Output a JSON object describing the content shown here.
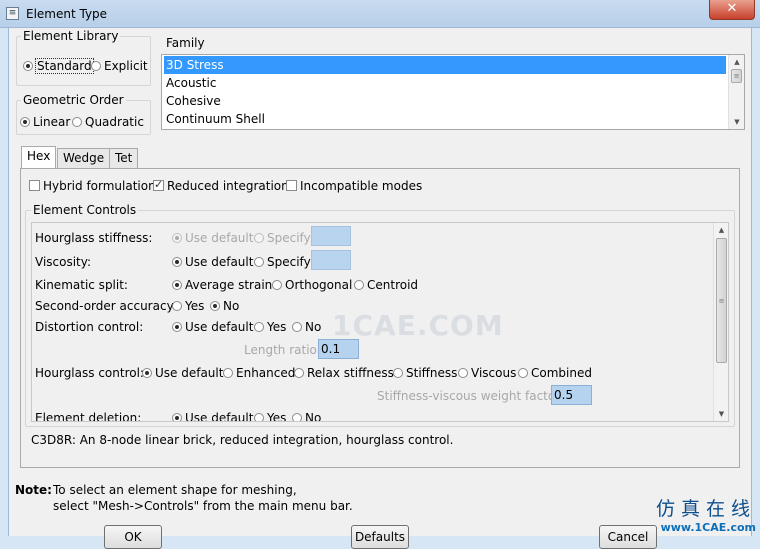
{
  "window": {
    "title": "Element Type",
    "close_glyph": "✕",
    "app_icon": "abaqus-app-icon"
  },
  "element_library": {
    "label": "Element Library",
    "options": [
      "Standard",
      "Explicit"
    ],
    "selected": "Standard"
  },
  "geometric_order": {
    "label": "Geometric Order",
    "options": [
      "Linear",
      "Quadratic"
    ],
    "selected": "Linear"
  },
  "family": {
    "label": "Family",
    "items": [
      "3D Stress",
      "Acoustic",
      "Cohesive",
      "Continuum Shell"
    ],
    "selected": "3D Stress"
  },
  "tabs": [
    {
      "label": "Hex",
      "active": true
    },
    {
      "label": "Wedge"
    },
    {
      "label": "Tet"
    }
  ],
  "formulation": {
    "hybrid": {
      "label": "Hybrid formulation",
      "checked": false
    },
    "reduced": {
      "label": "Reduced integration",
      "checked": true
    },
    "incompatible": {
      "label": "Incompatible modes",
      "checked": false
    }
  },
  "element_controls": {
    "label": "Element Controls",
    "hourglass_stiffness": {
      "label": "Hourglass stiffness:",
      "use_default": "Use default",
      "specify": "Specify",
      "value": ""
    },
    "viscosity": {
      "label": "Viscosity:",
      "use_default": "Use default",
      "specify": "Specify",
      "value": ""
    },
    "kinematic_split": {
      "label": "Kinematic split:",
      "options": [
        "Average strain",
        "Orthogonal",
        "Centroid"
      ],
      "selected": "Average strain"
    },
    "second_order": {
      "label": "Second-order accuracy:",
      "options": [
        "Yes",
        "No"
      ],
      "selected": "No"
    },
    "distortion_control": {
      "label": "Distortion control:",
      "options": [
        "Use default",
        "Yes",
        "No"
      ],
      "selected": "Use default",
      "length_ratio_label": "Length ratio:",
      "length_ratio": "0.1"
    },
    "hourglass_control": {
      "label": "Hourglass control:",
      "options": [
        "Use default",
        "Enhanced",
        "Relax stiffness",
        "Stiffness",
        "Viscous",
        "Combined"
      ],
      "selected": "Use default",
      "weight_label": "Stiffness-viscous weight factor:",
      "weight": "0.5"
    },
    "element_deletion": {
      "label": "Element deletion:",
      "options": [
        "Use default",
        "Yes",
        "No"
      ],
      "selected": "Use default"
    }
  },
  "description": "C3D8R:  An 8-node linear brick, reduced integration, hourglass control.",
  "note": {
    "label": "Note:",
    "line1": "To select an element shape for meshing,",
    "line2": "select \"Mesh->Controls\" from the main menu bar."
  },
  "buttons": {
    "ok": "OK",
    "defaults": "Defaults",
    "cancel": "Cancel"
  },
  "watermark": "1CAE.COM",
  "brand": {
    "chinese": "仿真在线",
    "url": "www.1CAE.com"
  }
}
